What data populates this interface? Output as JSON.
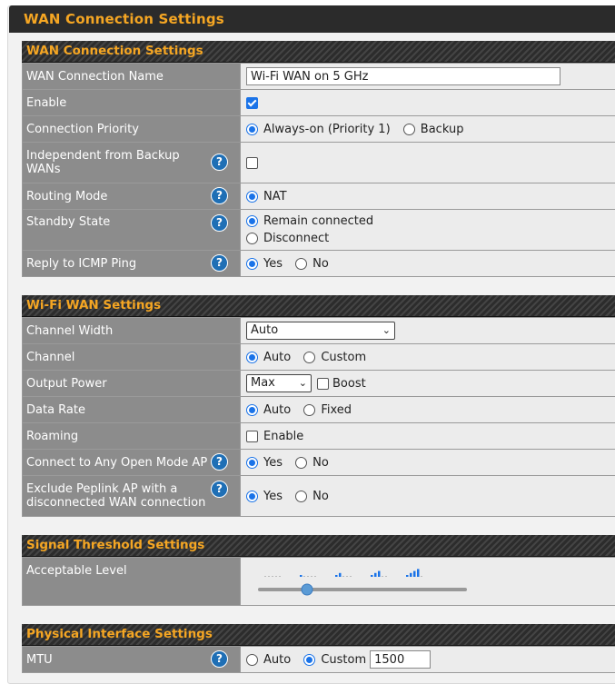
{
  "page": {
    "title": "WAN Connection Settings"
  },
  "wan_section": {
    "header": "WAN Connection Settings",
    "name_label": "WAN Connection Name",
    "name_value": "Wi-Fi WAN on 5 GHz",
    "enable_label": "Enable",
    "priority_label": "Connection Priority",
    "priority_always": "Always-on (Priority 1)",
    "priority_backup": "Backup",
    "independent_label": "Independent from Backup WANs",
    "routing_label": "Routing Mode",
    "routing_nat": "NAT",
    "standby_label": "Standby State",
    "standby_remain": "Remain connected",
    "standby_disconnect": "Disconnect",
    "icmp_label": "Reply to ICMP Ping",
    "icmp_yes": "Yes",
    "icmp_no": "No"
  },
  "wifi_section": {
    "header": "Wi-Fi WAN Settings",
    "width_label": "Channel Width",
    "width_value": "Auto",
    "channel_label": "Channel",
    "channel_auto": "Auto",
    "channel_custom": "Custom",
    "power_label": "Output Power",
    "power_value": "Max",
    "power_boost": "Boost",
    "rate_label": "Data Rate",
    "rate_auto": "Auto",
    "rate_fixed": "Fixed",
    "roaming_label": "Roaming",
    "roaming_enable": "Enable",
    "open_label": "Connect to Any Open Mode AP",
    "open_yes": "Yes",
    "open_no": "No",
    "exclude_label": "Exclude Peplink AP with a disconnected WAN connection",
    "exclude_yes": "Yes",
    "exclude_no": "No"
  },
  "signal_section": {
    "header": "Signal Threshold Settings",
    "level_label": "Acceptable Level",
    "level_selected": 1,
    "levels_total": 5
  },
  "physical_section": {
    "header": "Physical Interface Settings",
    "mtu_label": "MTU",
    "mtu_auto": "Auto",
    "mtu_custom": "Custom",
    "mtu_value": "1500"
  },
  "icons": {
    "help": "question-circle-icon",
    "help_glyph": "?",
    "dropdown": "chevron-down-icon"
  }
}
